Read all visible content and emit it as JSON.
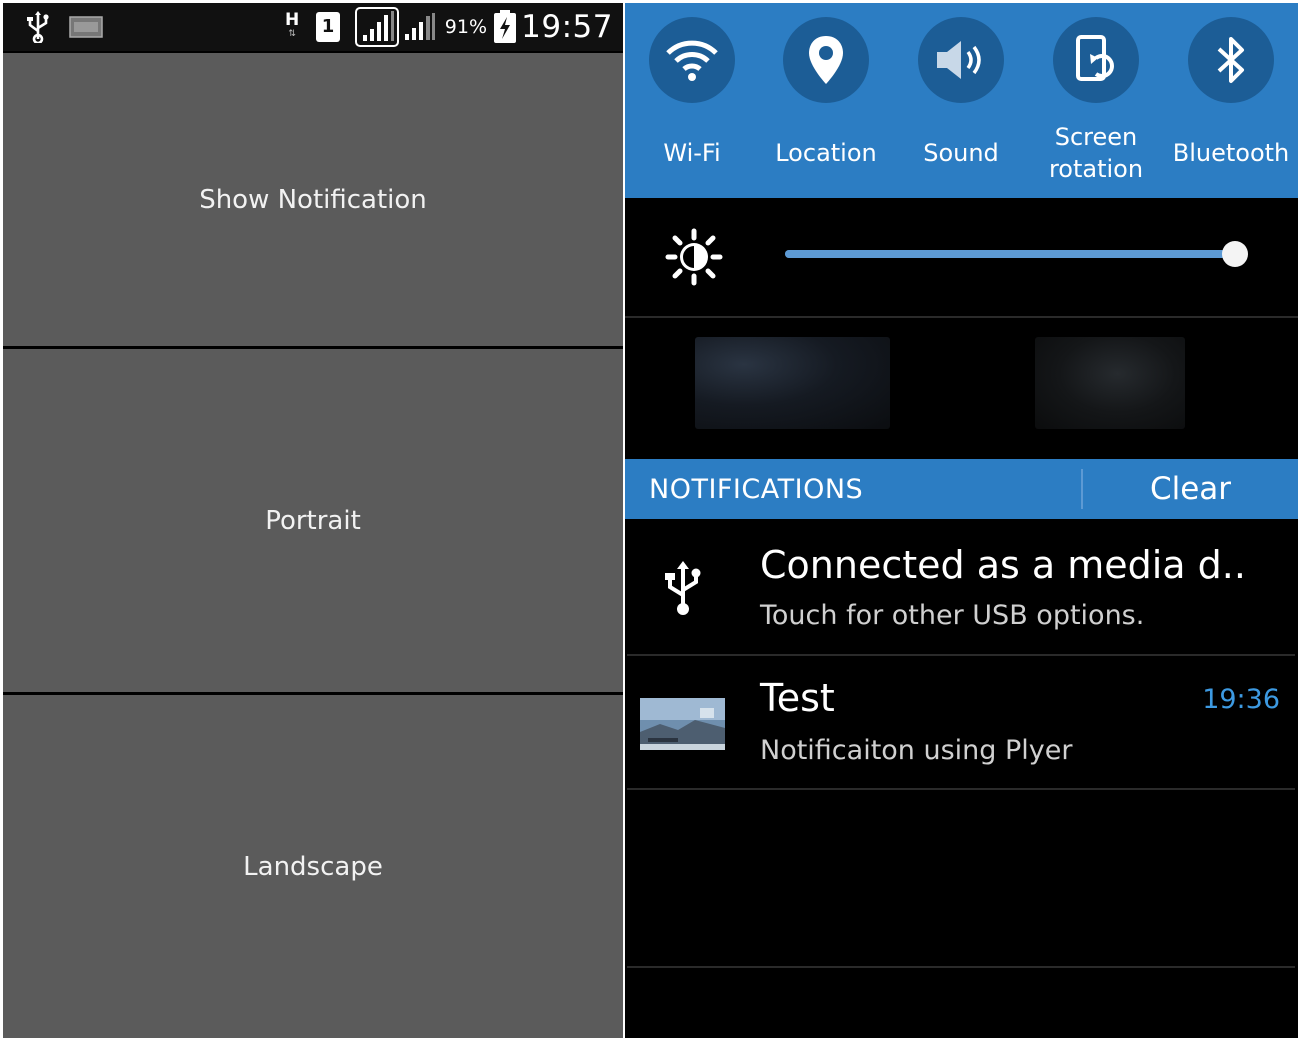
{
  "status_bar": {
    "network_type": "H",
    "sim_slot": "1",
    "battery_percent": "91%",
    "time": "19:57",
    "icons": [
      "usb-icon",
      "image-icon",
      "network-h-icon",
      "sim-icon",
      "signal-icon",
      "signal-icon",
      "battery-charging-icon"
    ]
  },
  "app": {
    "buttons": [
      {
        "label": "Show Notification"
      },
      {
        "label": "Portrait"
      },
      {
        "label": "Landscape"
      }
    ],
    "button_color": "#5b5b5b"
  },
  "quick_settings": {
    "background": "#2c7dc3",
    "items": [
      {
        "label": "Wi-Fi",
        "icon": "wifi-icon"
      },
      {
        "label": "Location",
        "icon": "location-pin-icon"
      },
      {
        "label": "Sound",
        "icon": "speaker-icon"
      },
      {
        "label": "Screen rotation",
        "label_line1": "Screen",
        "label_line2": "rotation",
        "icon": "screen-rotation-icon"
      },
      {
        "label": "Bluetooth",
        "icon": "bluetooth-icon"
      }
    ]
  },
  "brightness": {
    "icon": "brightness-icon",
    "level": 1.0
  },
  "notifications": {
    "header": "NOTIFICATIONS",
    "clear_label": "Clear",
    "items": [
      {
        "icon": "usb-icon",
        "title": "Connected as a media d..",
        "subtitle": "Touch for other USB options."
      },
      {
        "icon": "app-thumbnail",
        "title": "Test",
        "subtitle": "Notificaiton using Plyer",
        "time": "19:36"
      }
    ],
    "time_color": "#3d9ae2"
  }
}
